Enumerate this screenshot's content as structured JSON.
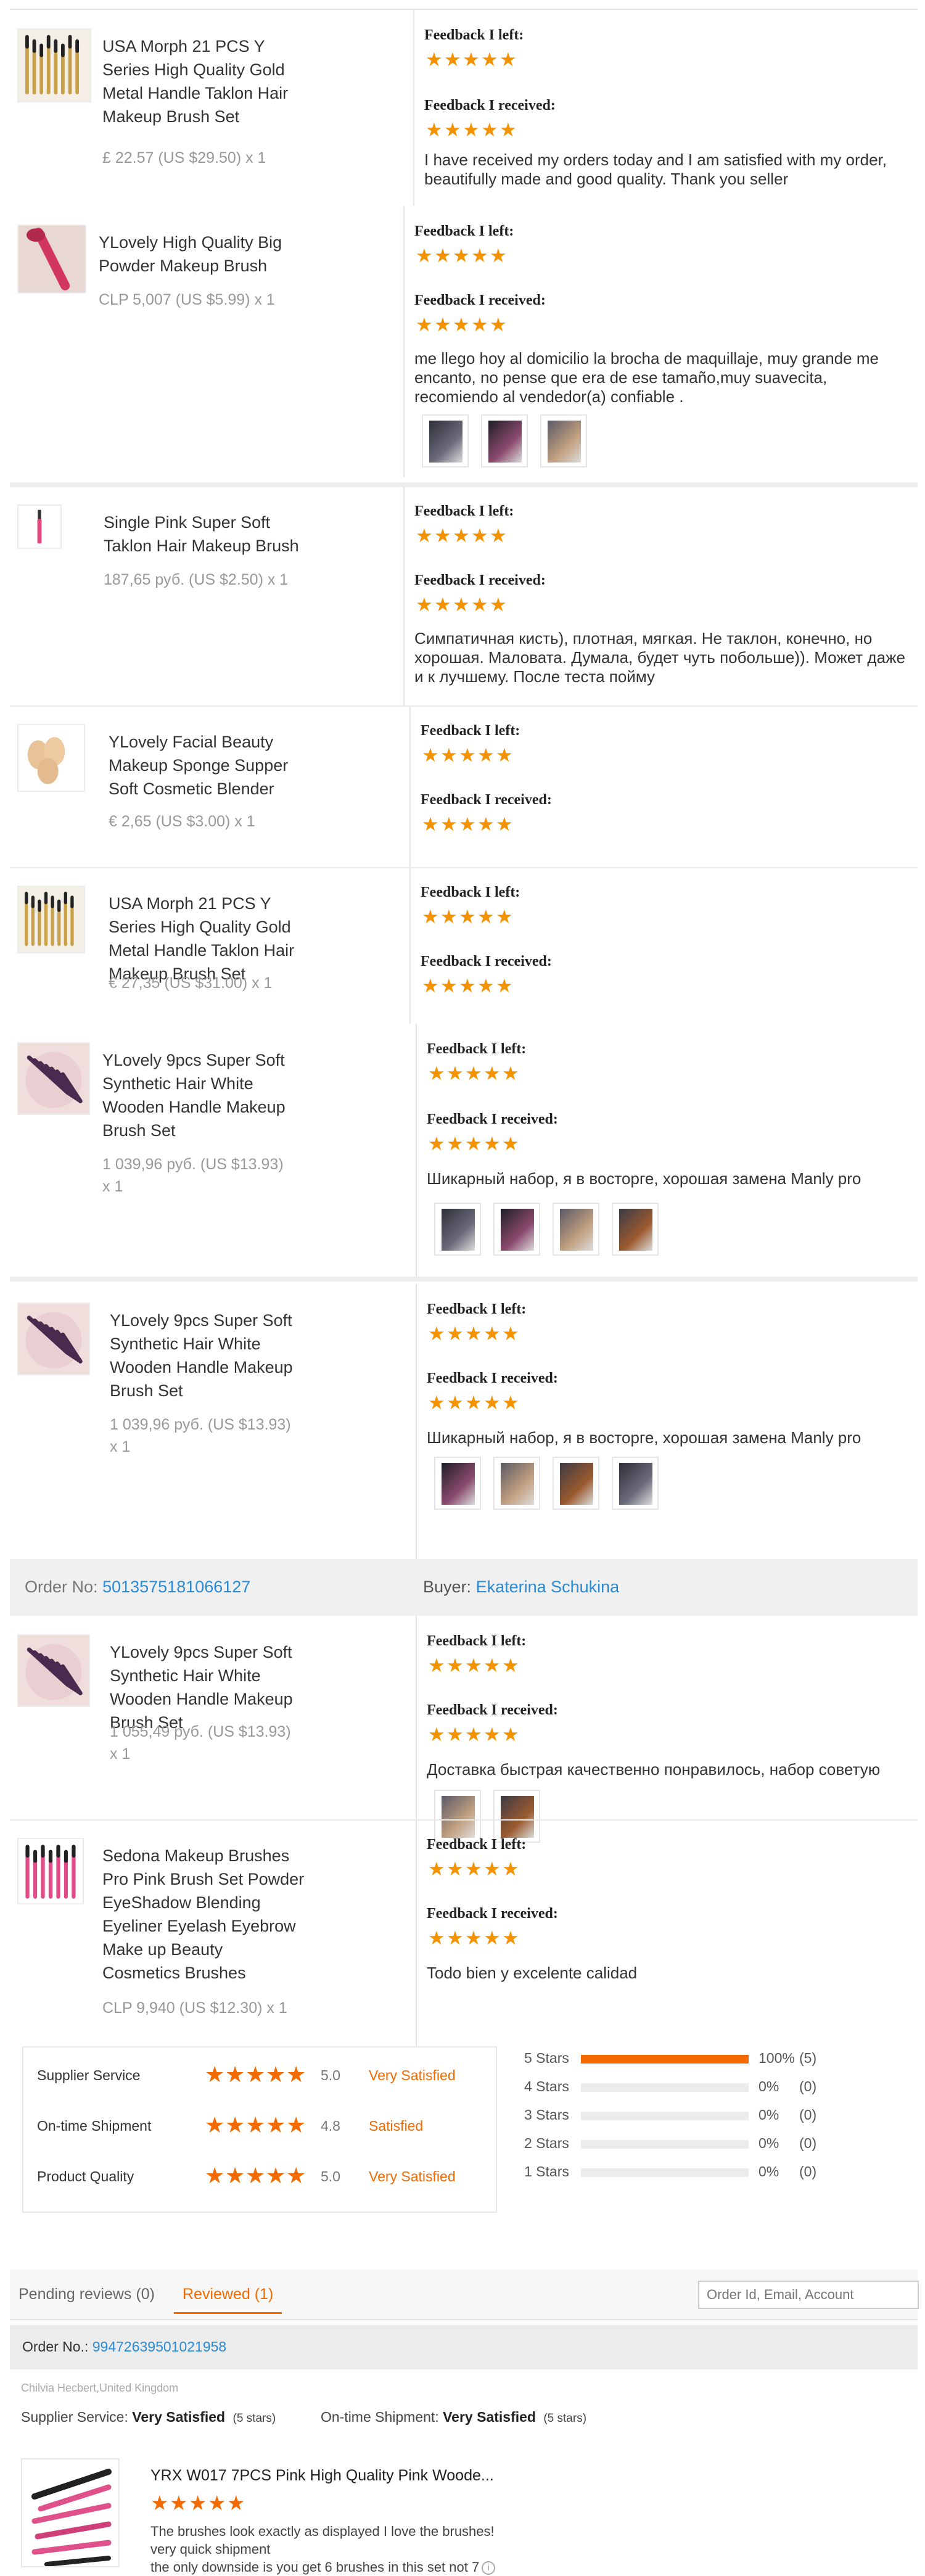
{
  "labels": {
    "feedback_left": "Feedback I left:",
    "feedback_received": "Feedback I received:"
  },
  "feedback_items": [
    {
      "name_lines": [
        "USA Morph 21 PCS Y",
        "Series High Quality Gold",
        "Metal Handle Taklon Hair",
        "Makeup Brush Set"
      ],
      "price": "£ 22.57 (US $29.50) x 1",
      "left_stars": 5,
      "received_stars": 5,
      "comment_lines": [
        "I have received my orders today and I am satisfied with my order,",
        "beautifully made and good quality. Thank you seller"
      ],
      "photos": 0,
      "thumb_icon": "brush-set-thumbnail"
    },
    {
      "name_lines": [
        "YLovely High Quality Big",
        "Powder Makeup Brush"
      ],
      "price": "CLP 5,007 (US $5.99) x 1",
      "left_stars": 5,
      "received_stars": 5,
      "comment_lines": [
        "me llego hoy al domicilio la brocha de maquillaje, muy grande me",
        "encanto, no pense que era de ese tamaño,muy suavecita,",
        "recomiendo al vendedor(a) confiable ."
      ],
      "photos": 3,
      "thumb_icon": "powder-brush-thumbnail"
    },
    {
      "name_lines": [
        "Single Pink Super Soft",
        "Taklon Hair Makeup Brush"
      ],
      "price": "187,65 руб. (US $2.50) x 1",
      "left_stars": 5,
      "received_stars": 5,
      "comment_lines": [
        "Симпатичная кисть), плотная, мягкая. Не таклон, конечно, но",
        "хорошая. Маловата. Думала, будет чуть побольше)). Может даже",
        "и к лучшему. После теста пойму"
      ],
      "photos": 0,
      "thumb_icon": "pink-brush-thumbnail"
    },
    {
      "name_lines": [
        "YLovely Facial Beauty",
        "Makeup Sponge Supper",
        "Soft Cosmetic Blender"
      ],
      "price": "€ 2,65 (US $3.00) x 1",
      "left_stars": 5,
      "received_stars": 5,
      "comment_lines": [],
      "photos": 0,
      "thumb_icon": "sponge-thumbnail"
    },
    {
      "name_lines": [
        "USA Morph 21 PCS Y",
        "Series High Quality Gold",
        "Metal Handle Taklon Hair",
        "Makeup Brush Set"
      ],
      "price": "€ 27,35 (US $31.00) x 1",
      "left_stars": 5,
      "received_stars": 5,
      "comment_lines": [],
      "photos": 0,
      "thumb_icon": "brush-set-thumbnail"
    },
    {
      "name_lines": [
        "YLovely 9pcs Super Soft",
        "Synthetic Hair White",
        "Wooden Handle Makeup",
        "Brush Set"
      ],
      "price_lines": [
        "1 039,96 руб. (US $13.93)",
        "x 1"
      ],
      "left_stars": 5,
      "received_stars": 5,
      "comment_lines": [
        "Шикарный набор, я в восторге, хорошая замена Manly pro"
      ],
      "photos": 4,
      "thumb_icon": "purple-brush-set-thumbnail"
    },
    {
      "name_lines": [
        "YLovely 9pcs Super Soft",
        "Synthetic Hair White",
        "Wooden Handle Makeup",
        "Brush Set"
      ],
      "price_lines": [
        "1 039,96 руб. (US $13.93)",
        "x 1"
      ],
      "left_stars": 5,
      "received_stars": 5,
      "comment_lines": [
        "Шикарный набор, я в восторге, хорошая замена Manly pro"
      ],
      "photos": 4,
      "thumb_icon": "purple-brush-set-thumbnail"
    },
    {
      "name_lines": [
        "YLovely 9pcs Super Soft",
        "Synthetic Hair White",
        "Wooden Handle Makeup",
        "Brush Set"
      ],
      "price_lines": [
        "1 055,49 руб. (US $13.93)",
        "x 1"
      ],
      "left_stars": 5,
      "received_stars": 5,
      "comment_lines": [
        "Доставка быстрая качественно понравилось, набор советую"
      ],
      "photos": 2,
      "thumb_icon": "purple-brush-set-thumbnail"
    },
    {
      "name_lines": [
        "Sedona Makeup Brushes",
        "Pro Pink Brush Set Powder",
        "EyeShadow Blending",
        "Eyeliner Eyelash Eyebrow",
        "Make up Beauty",
        "Cosmetics Brushes"
      ],
      "price": "CLP 9,940 (US $12.30) x 1",
      "left_stars": 5,
      "received_stars": 5,
      "comment_lines": [
        "Todo bien y excelente calidad"
      ],
      "photos": 0,
      "thumb_icon": "pink-brush-set-thumbnail"
    }
  ],
  "order_bar": {
    "order_label": "Order No:",
    "order_no": "5013575181066127",
    "buyer_label": "Buyer:",
    "buyer": "Ekaterina Schukina"
  },
  "ratings": {
    "rows": [
      {
        "name": "Supplier Service",
        "score": "5.0",
        "label": "Very Satisfied"
      },
      {
        "name": "On-time Shipment",
        "score": "4.8",
        "label": "Satisfied"
      },
      {
        "name": "Product Quality",
        "score": "5.0",
        "label": "Very Satisfied"
      }
    ],
    "histogram": [
      {
        "label": "5 Stars",
        "fraction": 1.0,
        "pct": "100%",
        "count": "(5)"
      },
      {
        "label": "4 Stars",
        "fraction": 0,
        "pct": "0%",
        "count": "(0)"
      },
      {
        "label": "3 Stars",
        "fraction": 0,
        "pct": "0%",
        "count": "(0)"
      },
      {
        "label": "2 Stars",
        "fraction": 0,
        "pct": "0%",
        "count": "(0)"
      },
      {
        "label": "1 Stars",
        "fraction": 0,
        "pct": "0%",
        "count": "(0)"
      }
    ]
  },
  "tabs": {
    "pending": "Pending reviews (0)",
    "reviewed": "Reviewed (1)",
    "search_placeholder": "Order Id, Email, Account"
  },
  "review": {
    "order_label": "Order No.:",
    "order_no": "99472639501021958",
    "buyer_line": "Chilvia Hecbert,United Kingdom",
    "supplier_label": "Supplier Service:",
    "supplier_value": "Very Satisfied",
    "supplier_stars": "(5 stars)",
    "shipment_label": "On-time Shipment:",
    "shipment_value": "Very Satisfied",
    "shipment_stars": "(5 stars)",
    "title": "YRX W017 7PCS Pink High Quality Pink Woode...",
    "stars": 5,
    "text_lines": [
      "The brushes look exactly as displayed I love the brushes!",
      "very quick shipment",
      "the only downside is you get 6 brushes in this set not 7"
    ]
  },
  "colors": {
    "accent": "#f26a00",
    "star": "#f59200",
    "link": "#2a8ad4"
  }
}
